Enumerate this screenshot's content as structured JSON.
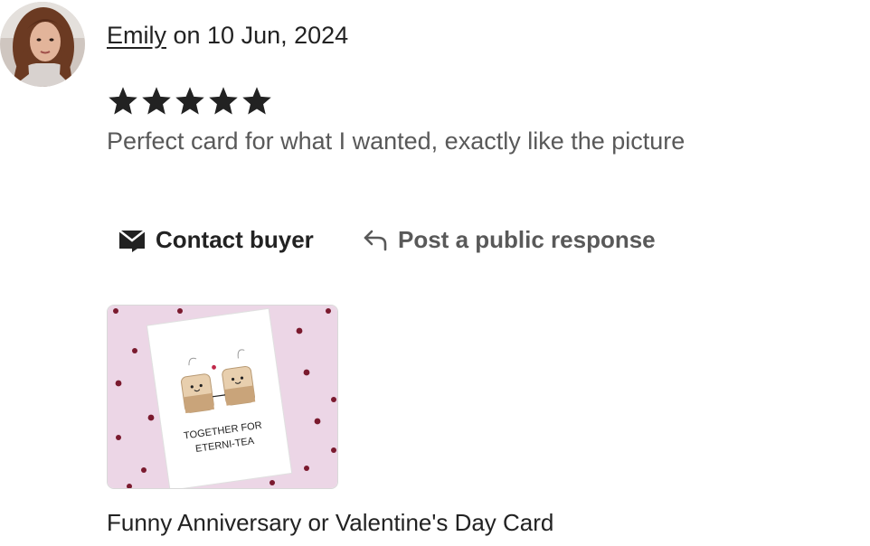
{
  "review": {
    "reviewer_name": "Emily",
    "date_text": " on 10 Jun, 2024",
    "rating": 5,
    "rating_max": 5,
    "text": "Perfect card for what I wanted, exactly like the picture"
  },
  "actions": {
    "contact_label": "Contact buyer",
    "respond_label": "Post a public response",
    "contact_icon": "envelope-icon",
    "respond_icon": "reply-arrow-icon"
  },
  "listing": {
    "title": "Funny Anniversary or Valentine's Day Card",
    "card_text_line1": "TOGETHER FOR",
    "card_text_line2": "ETERNI-TEA"
  },
  "colors": {
    "star": "#222222",
    "muted_text": "#595959",
    "thumb_background": "#ecd6e6",
    "heart": "#7a1a2e"
  }
}
